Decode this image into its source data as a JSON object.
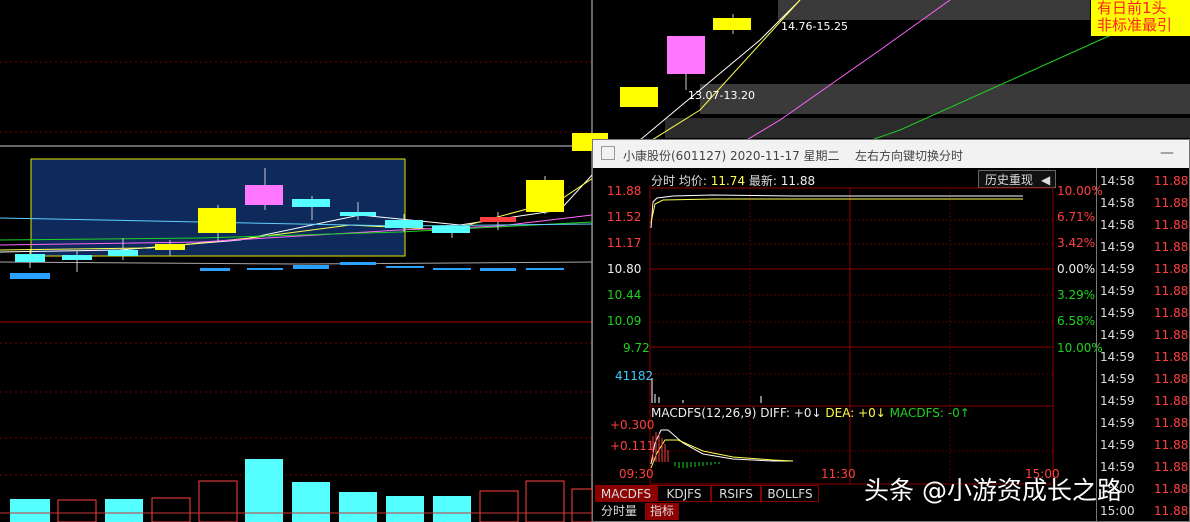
{
  "popup": {
    "title": "小康股份(601127) 2020-11-17 星期二",
    "hint": "左右方向键切换分时",
    "close_glyph": "—"
  },
  "header": {
    "label_fenshi": "分时",
    "label_avg": "均价:",
    "avg_value": "11.74",
    "label_latest": "最新:",
    "latest_value": "11.88",
    "history_button": "历史重现"
  },
  "price_axis": [
    "11.88",
    "11.52",
    "11.17",
    "10.80",
    "10.44",
    "10.09",
    "9.72"
  ],
  "pct_axis": [
    "10.00%",
    "6.71%",
    "3.42%",
    "0.00%",
    "3.29%",
    "6.58%",
    "10.00%"
  ],
  "volume_max": "41182",
  "macd": {
    "title": "MACDFS(12,26,9)",
    "diff": "DIFF: +0↓",
    "dea": "DEA: +0↓",
    "macdfs": "MACDFS: -0↑",
    "y_top": "+0.300",
    "y_mid": "+0.111"
  },
  "time_axis": [
    "09:30",
    "11:30",
    "15:00"
  ],
  "tabs": [
    "MACDFS",
    "KDJFS",
    "RSIFS",
    "BOLLFS"
  ],
  "tabs2": [
    "分时量",
    "指标"
  ],
  "ticks": [
    {
      "time": "14:58",
      "price": "11.88"
    },
    {
      "time": "14:58",
      "price": "11.88"
    },
    {
      "time": "14:58",
      "price": "11.88"
    },
    {
      "time": "14:59",
      "price": "11.88"
    },
    {
      "time": "14:59",
      "price": "11.88"
    },
    {
      "time": "14:59",
      "price": "11.88"
    },
    {
      "time": "14:59",
      "price": "11.88"
    },
    {
      "time": "14:59",
      "price": "11.88"
    },
    {
      "time": "14:59",
      "price": "11.88"
    },
    {
      "time": "14:59",
      "price": "11.88"
    },
    {
      "time": "14:59",
      "price": "11.88"
    },
    {
      "time": "14:59",
      "price": "11.88"
    },
    {
      "time": "14:59",
      "price": "11.88"
    },
    {
      "time": "14:59",
      "price": "11.88"
    },
    {
      "time": "15:00",
      "price": "11.88"
    },
    {
      "time": "15:00",
      "price": "11.88"
    }
  ],
  "range_labels": [
    "14.76-15.25",
    "13.07-13.20"
  ],
  "notice_text": [
    "有日前1头",
    "非标准最引"
  ],
  "watermark": "头条 @小游资成长之路",
  "colors": {
    "up": "#ff4040",
    "down": "#20d020",
    "avg": "#ffff4d",
    "accent": "#8b0000"
  }
}
